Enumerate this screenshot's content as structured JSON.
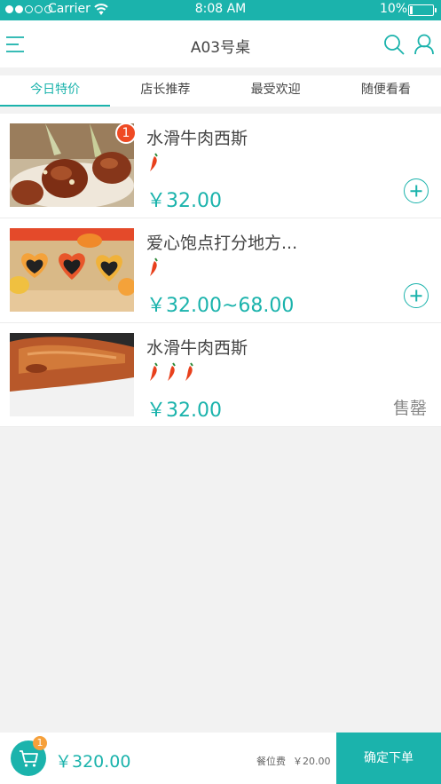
{
  "status_bar": {
    "carrier": "Carrier",
    "time": "8:08 AM",
    "battery": "10%",
    "signal_bars_filled": 2,
    "signal_bars_total": 5
  },
  "header": {
    "title": "A03号桌",
    "menu_icon": "menu-icon",
    "search_icon": "search-icon",
    "user_icon": "user-icon"
  },
  "tabs": [
    {
      "label": "今日特价",
      "active": true
    },
    {
      "label": "店长推荐",
      "active": false
    },
    {
      "label": "最受欢迎",
      "active": false
    },
    {
      "label": "随便看看",
      "active": false
    }
  ],
  "dishes": [
    {
      "name": "水滑牛肉西斯",
      "spice": 1,
      "price": "￥32.00",
      "action": "add",
      "qty_badge": "1"
    },
    {
      "name": "爱心饱点打分地方...",
      "spice": 1,
      "price": "￥32.00~68.00",
      "action": "add"
    },
    {
      "name": "水滑牛肉西斯",
      "spice": 3,
      "price": "￥32.00",
      "action": "soldout",
      "soldout_label": "售罄"
    }
  ],
  "bottom_bar": {
    "cart_count": "1",
    "total": "￥320.00",
    "seat_fee_label": "餐位费",
    "seat_fee_amount": "￥20.00",
    "confirm_label": "确定下单"
  },
  "colors": {
    "accent": "#1bb3ac",
    "badge_red": "#ef4a24",
    "badge_orange": "#f6a03a",
    "chili": "#e8401c"
  }
}
